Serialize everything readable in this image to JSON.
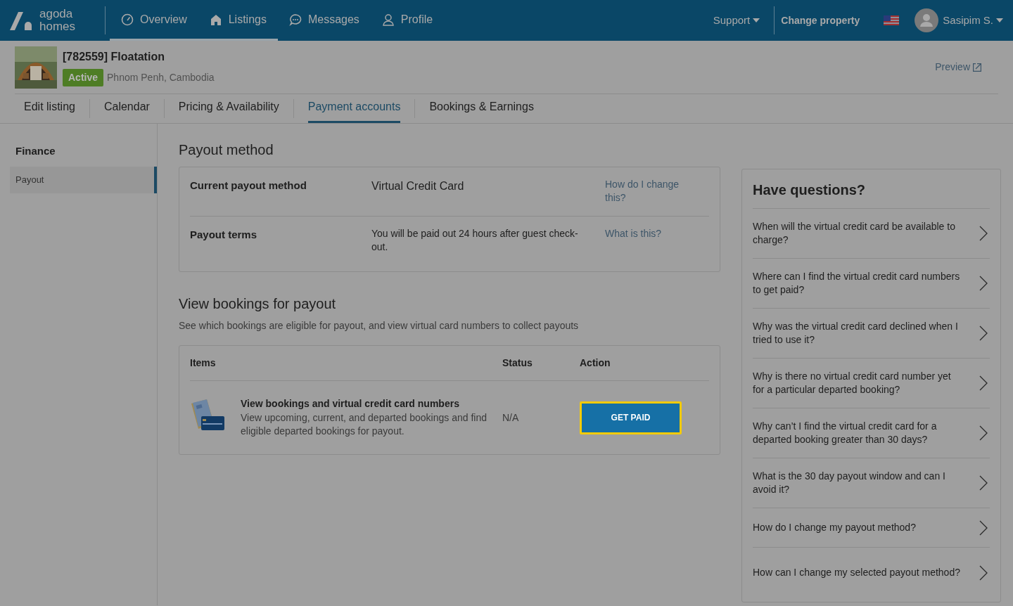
{
  "brand": {
    "line_1": "agoda",
    "line_2": "homes"
  },
  "nav": [
    {
      "label": "Overview",
      "selected": true
    },
    {
      "label": "Listings",
      "selected": true
    },
    {
      "label": "Messages",
      "selected": false
    },
    {
      "label": "Profile",
      "selected": false
    }
  ],
  "header_right": {
    "support": "Support",
    "change_property": "Change property",
    "user": "Sasipim S."
  },
  "property": {
    "title": "[782559] Floatation",
    "status": "Active",
    "location": "Phnom Penh, Cambodia",
    "preview": "Preview"
  },
  "tabs": [
    {
      "label": "Edit listing",
      "selected": false
    },
    {
      "label": "Calendar",
      "selected": false
    },
    {
      "label": "Pricing & Availability",
      "selected": false
    },
    {
      "label": "Payment accounts",
      "selected": true
    },
    {
      "label": "Bookings & Earnings",
      "selected": false
    }
  ],
  "sidebar": {
    "heading": "Finance",
    "items": [
      {
        "label": "Payout",
        "selected": true
      }
    ]
  },
  "payout_method": {
    "title": "Payout method",
    "rows": [
      {
        "label": "Current payout method",
        "value": "Virtual Credit Card",
        "link": "How do I change this?"
      },
      {
        "label": "Payout terms",
        "value": "You will be paid out 24 hours after guest check-out.",
        "link": "What is this?"
      }
    ]
  },
  "bookings": {
    "title": "View bookings for payout",
    "subtitle": "See which bookings are eligible for payout, and view virtual card numbers to collect payouts",
    "columns": [
      "Items",
      "Status",
      "Action"
    ],
    "rows": [
      {
        "title": "View bookings and virtual credit card numbers",
        "description": "View upcoming, current, and departed bookings and find eligible departed bookings for payout.",
        "status": "N/A",
        "action": "GET PAID",
        "highlighted": true
      }
    ]
  },
  "questions": {
    "title": "Have questions?",
    "items": [
      "When will the virtual credit card be available to charge?",
      "Where can I find the virtual credit card numbers to get paid?",
      "Why was the virtual credit card declined when I tried to use it?",
      "Why is there no virtual credit card number yet for a particular departed booking?",
      "Why can’t I find the virtual credit card for a departed booking greater than 30 days?",
      "What is the 30 day payout window and can I avoid it?",
      "How do I change my payout method?",
      "How can I change my selected payout method?"
    ]
  }
}
